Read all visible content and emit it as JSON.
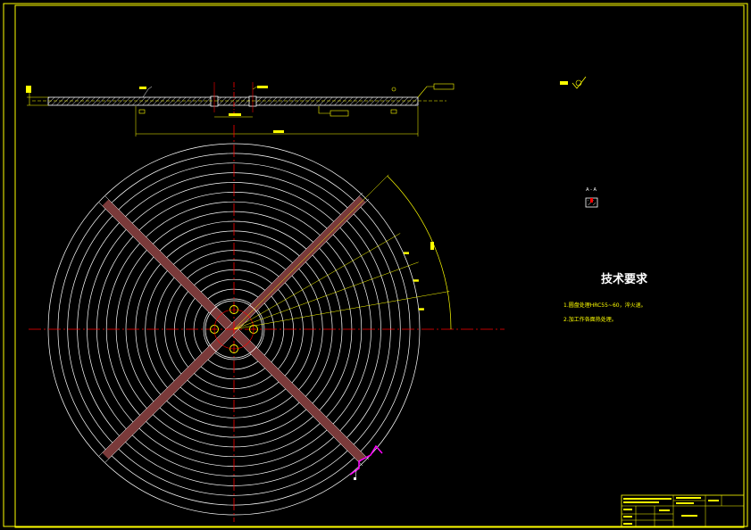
{
  "notes": {
    "title": "技术要求",
    "line1": "1.圆盘处理HRC55~60，淬火退。",
    "line2": "2.加工作各面热处理。"
  },
  "section_label": "A - A",
  "colors": {
    "background": "#000000",
    "frame": "#ffff00",
    "rings": "#ffffff",
    "center_lines": "#ff0000",
    "dimensions": "#ffff00",
    "grooves": "#7a3a3a",
    "section_marker": "#ff00ff",
    "hatch": "#ffffff"
  },
  "drawing": {
    "ring_count": 17,
    "hole_count": 4,
    "radial_dim_count": 4,
    "arc_dim_count": 3,
    "groove_angles_deg": [
      45,
      135
    ]
  }
}
